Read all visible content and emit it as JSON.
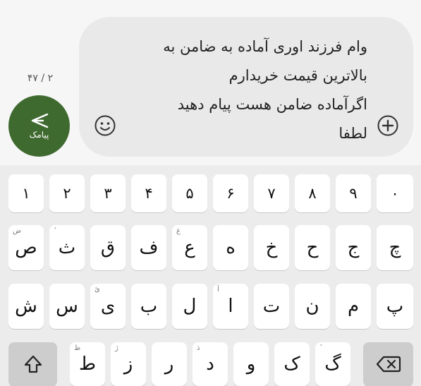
{
  "compose": {
    "message_text": "وام فرزند اوری آماده به ضامن به\nبالاترین قیمت خریدارم\nاگرآماده ضامن هست پیام دهید\nلطفا",
    "char_counter": "۲ / ۴۷",
    "send_label": "پیامک"
  },
  "colors": {
    "send_button": "#3f6a2f",
    "keyboard_bg": "#ececec",
    "bubble": "#e9e9e9"
  },
  "keyboard": {
    "row1": [
      "۱",
      "۲",
      "۳",
      "۴",
      "۵",
      "۶",
      "۷",
      "۸",
      "۹",
      "۰"
    ],
    "row2": [
      {
        "label": "ص",
        "hint": "ض"
      },
      {
        "label": "ث",
        "hint": "ٔ"
      },
      {
        "label": "ق",
        "hint": ""
      },
      {
        "label": "ف",
        "hint": ""
      },
      {
        "label": "ع",
        "hint": "غ"
      },
      {
        "label": "ه",
        "hint": ""
      },
      {
        "label": "خ",
        "hint": ""
      },
      {
        "label": "ح",
        "hint": ""
      },
      {
        "label": "ج",
        "hint": ""
      },
      {
        "label": "چ",
        "hint": ""
      }
    ],
    "row3": [
      {
        "label": "ش",
        "hint": ""
      },
      {
        "label": "س",
        "hint": ""
      },
      {
        "label": "ی",
        "hint": "ئ"
      },
      {
        "label": "ب",
        "hint": ""
      },
      {
        "label": "ل",
        "hint": ""
      },
      {
        "label": "ا",
        "hint": "آ"
      },
      {
        "label": "ت",
        "hint": ""
      },
      {
        "label": "ن",
        "hint": ""
      },
      {
        "label": "م",
        "hint": ""
      },
      {
        "label": "پ",
        "hint": ""
      }
    ],
    "row4": [
      {
        "label": "ط",
        "hint": "ظ"
      },
      {
        "label": "ز",
        "hint": "ژ"
      },
      {
        "label": "ر",
        "hint": ""
      },
      {
        "label": "د",
        "hint": "ذ"
      },
      {
        "label": "و",
        "hint": ""
      },
      {
        "label": "ک",
        "hint": ""
      },
      {
        "label": "گ",
        "hint": "ٔ"
      }
    ]
  }
}
